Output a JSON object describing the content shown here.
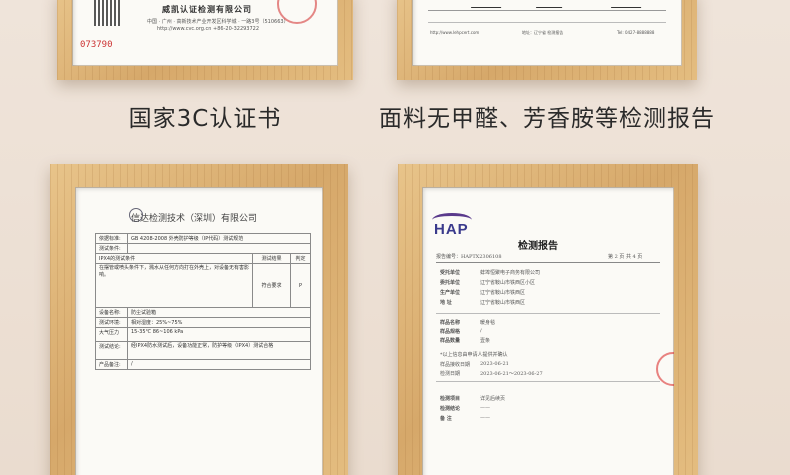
{
  "top_left_doc": {
    "org_name": "威凯认证检测有限公司",
    "address": "中国 · 广州 · 高新技术产业开发区科学城 · 一路3号（510663）",
    "contact": "http://www.cvc.org.cn          +86-20-32293722",
    "serial": "073790"
  },
  "top_right_doc": {
    "footer_left": "http://www.lehpcert.com",
    "footer_mid": "地址：辽宁省 检测报告",
    "footer_right": "Tel: 0427-8888888"
  },
  "captions": {
    "left": "国家3C认证书",
    "right": "面料无甲醛、芳香胺等检测报告"
  },
  "left_report": {
    "company": "信达检测技术（深圳）有限公司",
    "standard_label": "依据标准:",
    "standard_value": "GB 4208-2008  外壳防护等级（IP代码）测试规范",
    "conditions_label": "测试条件:",
    "section_title": "IPX4的测试条件",
    "col_result": "测试结果",
    "col_verdict": "判定",
    "row_text": "在摆管或喷头条件下，溅水从任何方向打在外壳上，对设备无有害影响。",
    "row_result": "符合要求",
    "row_verdict": "P",
    "equipment_label": "设备名称:",
    "equipment_value": "防尘试验箱",
    "env_label": "测试环境:",
    "env_value": "相对湿度：25%~75%",
    "pressure_label": "大气压力",
    "pressure_value": "15-35℃ 86~106 kPa",
    "conclusion_label": "测试结论:",
    "conclusion_value": "经IPX4防水测试后，设备功能正常，防护等级（IPX4）测试合格",
    "notes_label": "产品备注:",
    "notes_value": "/"
  },
  "right_report": {
    "logo": "HAP",
    "title": "检测报告",
    "report_no": "报告编号：HAPTX2306108",
    "page_info": "第 2 页 共 4 页",
    "rows": [
      {
        "label": "受托单位",
        "value": "蚌埠恒聚电子商务有限公司"
      },
      {
        "label": "委托单位",
        "value": "辽宁省鞍山市铁西区小区"
      },
      {
        "label": "生产单位",
        "value": "辽宁省鞍山市铁西区"
      },
      {
        "label": "地    址",
        "value": "辽宁省鞍山市铁西区"
      }
    ],
    "sample_rows": [
      {
        "label": "样品名称",
        "value": "暖身毯"
      },
      {
        "label": "样品规格",
        "value": "/"
      },
      {
        "label": "样品数量",
        "value": "壹条"
      }
    ],
    "note": "*以上信息由申请人提供并确认",
    "receive_date_label": "样品接收日期",
    "receive_date": "2023-06-21",
    "test_date_label": "检测日期",
    "test_date": "2023-06-21～2023-06-27",
    "conclusion_label": "检测项目",
    "conclusion_value": "详见后续页",
    "result_label": "检测结论",
    "result_value": "——",
    "remark_label": "备    注",
    "remark_value": "——"
  }
}
